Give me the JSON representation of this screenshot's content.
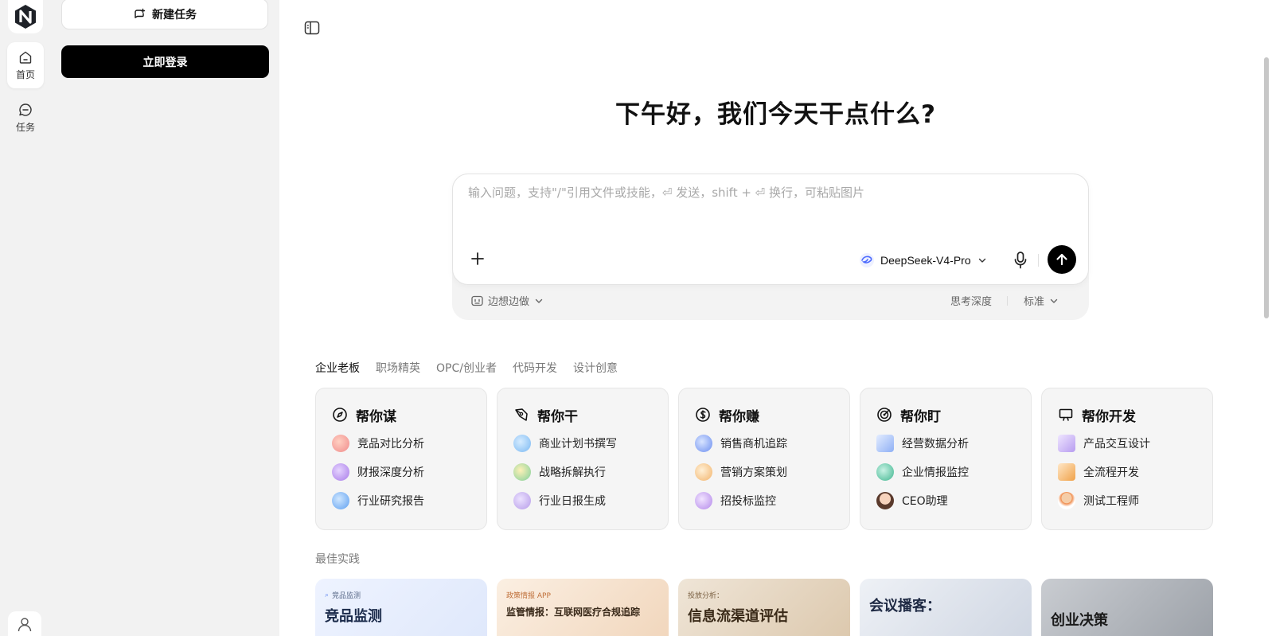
{
  "rail": {
    "items": [
      {
        "label": "首页",
        "icon": "home-icon",
        "active": true
      },
      {
        "label": "任务",
        "icon": "chat-icon",
        "active": false
      }
    ]
  },
  "panel": {
    "new_task": "新建任务",
    "login": "立即登录"
  },
  "main": {
    "greeting": "下午好，我们今天干点什么?",
    "composer": {
      "placeholder": "输入问题，支持\"/\"引用文件或技能，⏎ 发送，shift + ⏎ 换行，可粘贴图片",
      "model": "DeepSeek-V4-Pro",
      "mode": "边想边做",
      "depth_label": "思考深度",
      "depth_value": "标准"
    },
    "tabs": [
      "企业老板",
      "职场精英",
      "OPC/创业者",
      "代码开发",
      "设计创意"
    ],
    "cards": [
      {
        "title": "帮你谋",
        "icon": "compass-icon",
        "items": [
          "竞品对比分析",
          "财报深度分析",
          "行业研究报告"
        ]
      },
      {
        "title": "帮你干",
        "icon": "pen-icon",
        "items": [
          "商业计划书撰写",
          "战略拆解执行",
          "行业日报生成"
        ]
      },
      {
        "title": "帮你赚",
        "icon": "dollar-icon",
        "items": [
          "销售商机追踪",
          "营销方案策划",
          "招投标监控"
        ]
      },
      {
        "title": "帮你盯",
        "icon": "target-icon",
        "items": [
          "经营数据分析",
          "企业情报监控",
          "CEO助理"
        ]
      },
      {
        "title": "帮你开发",
        "icon": "monitor-icon",
        "items": [
          "产品交互设计",
          "全流程开发",
          "测试工程师"
        ]
      }
    ],
    "best_practice_label": "最佳实践",
    "thumbs": [
      {
        "small": "竞品监测",
        "big": "竞品监测"
      },
      {
        "small": "政策情报 APP",
        "big": "监管情报：互联网医疗合规追踪"
      },
      {
        "small": "投放分析：",
        "big": "信息流渠道评估"
      },
      {
        "small": "",
        "big": "会议播客："
      },
      {
        "small": "",
        "big": "创业决策"
      }
    ]
  },
  "colors": {
    "accent": "#000000",
    "sidebar_bg": "#f2f2f2",
    "card_bg": "#f5f5f5"
  }
}
